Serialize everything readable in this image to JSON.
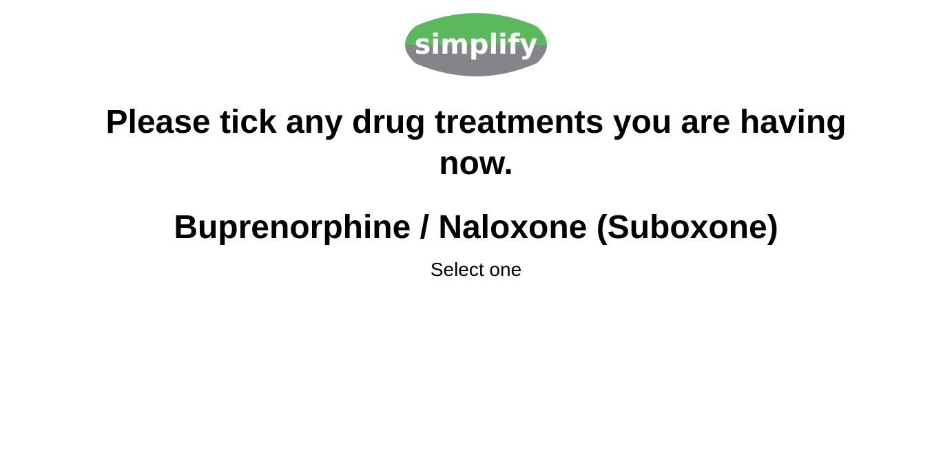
{
  "logo": {
    "text": "simplify",
    "icon": "simplify-logo",
    "colors": {
      "top": "#5cb85c",
      "bottom": "#848589",
      "text": "#ffffff"
    }
  },
  "question": {
    "title": "Please tick any drug treatments you are having now."
  },
  "drug": {
    "name": "Buprenorphine / Naloxone (Suboxone)",
    "instruction": "Select one"
  }
}
